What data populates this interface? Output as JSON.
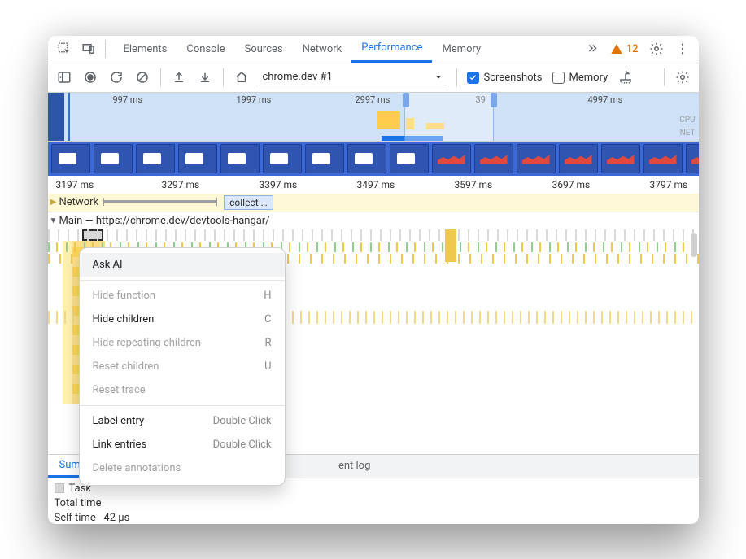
{
  "tabs": [
    "Elements",
    "Console",
    "Sources",
    "Network",
    "Performance",
    "Memory"
  ],
  "active_tab_index": 4,
  "warning_count": "12",
  "recording_name": "chrome.dev #1",
  "checkbox_screenshots": {
    "label": "Screenshots",
    "checked": true
  },
  "checkbox_memory": {
    "label": "Memory",
    "checked": false
  },
  "overview_ticks": [
    "997 ms",
    "1997 ms",
    "2997 ms",
    "39",
    "4997 ms"
  ],
  "overview_labels": {
    "cpu": "CPU",
    "net": "NET"
  },
  "ruler_ticks": [
    "3197 ms",
    "3297 ms",
    "3397 ms",
    "3497 ms",
    "3597 ms",
    "3697 ms",
    "3797 ms"
  ],
  "network_label": "Network",
  "collect_label": "collect …",
  "main_label": "Main — https://chrome.dev/devtools-hangar/",
  "context_menu": {
    "ask_ai": "Ask AI",
    "hide_function": "Hide function",
    "hide_function_sc": "H",
    "hide_children": "Hide children",
    "hide_children_sc": "C",
    "hide_repeating": "Hide repeating children",
    "hide_repeating_sc": "R",
    "reset_children": "Reset children",
    "reset_children_sc": "U",
    "reset_trace": "Reset trace",
    "label_entry": "Label entry",
    "label_entry_sc": "Double Click",
    "link_entries": "Link entries",
    "link_entries_sc": "Double Click",
    "delete_annotations": "Delete annotations"
  },
  "bottom_tabs": [
    "Summary",
    "ent log"
  ],
  "details": {
    "task_label": "Task",
    "total_time_label": "Total time",
    "self_time_label": "Self time",
    "self_time_value": "42 µs"
  }
}
